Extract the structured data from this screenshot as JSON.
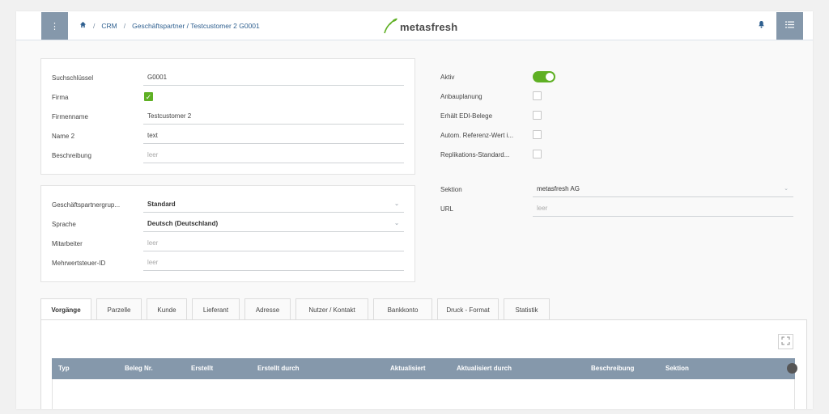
{
  "header": {
    "breadcrumb": {
      "crm": "CRM",
      "path": "Geschäftspartner / Testcustomer 2 G0001"
    },
    "logo_text": "metasfresh"
  },
  "form_main": {
    "suchschluessel_label": "Suchschlüssel",
    "suchschluessel_value": "G0001",
    "firma_label": "Firma",
    "firma_checked": true,
    "firmenname_label": "Firmenname",
    "firmenname_value": "Testcustomer 2",
    "name2_label": "Name 2",
    "name2_value": "text",
    "beschreibung_label": "Beschreibung",
    "beschreibung_placeholder": "leer"
  },
  "form_partner": {
    "gruppe_label": "Geschäftspartnergrup...",
    "gruppe_value": "Standard",
    "sprache_label": "Sprache",
    "sprache_value": "Deutsch (Deutschland)",
    "mitarbeiter_label": "Mitarbeiter",
    "mitarbeiter_placeholder": "leer",
    "mwst_label": "Mehrwertsteuer-ID",
    "mwst_placeholder": "leer"
  },
  "form_flags": {
    "aktiv_label": "Aktiv",
    "aktiv_on": true,
    "anbauplanung_label": "Anbauplanung",
    "edi_label": "Erhält EDI-Belege",
    "autom_label": "Autom. Referenz-Wert i...",
    "replikation_label": "Replikations-Standard..."
  },
  "form_section": {
    "sektion_label": "Sektion",
    "sektion_value": "metasfresh AG",
    "url_label": "URL",
    "url_placeholder": "leer"
  },
  "tabs": [
    "Vorgänge",
    "Parzelle",
    "Kunde",
    "Lieferant",
    "Adresse",
    "Nutzer / Kontakt",
    "Bankkonto",
    "Druck - Format",
    "Statistik"
  ],
  "active_tab": "Vorgänge",
  "grid": {
    "columns": [
      "Typ",
      "Beleg Nr.",
      "Erstellt",
      "Erstellt durch",
      "Aktualisiert",
      "Aktualisiert durch",
      "Beschreibung",
      "Sektion"
    ]
  },
  "colors": {
    "accent_green": "#5fb024",
    "header_button": "#8598ab",
    "link_blue": "#2e5f8f"
  },
  "icons": {
    "menu": "vertical-dots-icon",
    "home": "home-icon",
    "bell": "bell-icon",
    "list": "list-icon",
    "expand": "expand-icon",
    "checkmark": "checkmark-icon",
    "dropdown": "chevron-down-icon"
  }
}
